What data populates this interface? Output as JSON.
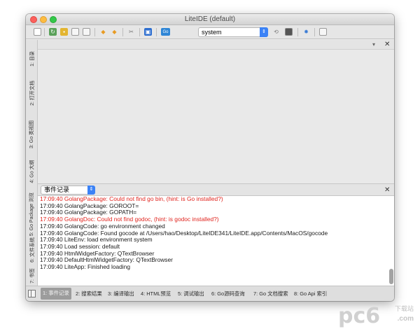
{
  "window": {
    "title": "LiteIDE (default)"
  },
  "toolbar": {
    "icons": [
      "new-file-icon",
      "open-file-icon",
      "open-folder-icon",
      "save-icon",
      "save-all-icon",
      "back-icon",
      "forward-icon",
      "tools-icon",
      "app-icon",
      "go-env-icon",
      "refresh-icon",
      "terminal-icon",
      "settings-icon",
      "window-icon"
    ],
    "env_value": "system"
  },
  "sidebar": {
    "tabs": [
      "1: 目录",
      "2: 打开文档",
      "3: Go 类视图",
      "4: Go 大纲",
      "5: Go Package 浏览",
      "6: 文件系统",
      "7: 书签"
    ]
  },
  "editor": {
    "header_buttons": [
      "▾",
      "✕"
    ]
  },
  "output": {
    "selector_value": "事件记录",
    "close_label": "✕",
    "log": [
      {
        "text": "17:09:40 GolangPackage: Could not find go bin, (hint: is Go installed?)",
        "level": "error"
      },
      {
        "text": "17:09:40 GolangPackage: GOROOT=",
        "level": "info"
      },
      {
        "text": "17:09:40 GolangPackage: GOPATH=",
        "level": "info"
      },
      {
        "text": "17:09:40 GolangDoc: Could not find godoc, (hint: is godoc installed?)",
        "level": "error"
      },
      {
        "text": "17:09:40 GolangCode: go environment changed",
        "level": "info"
      },
      {
        "text": "17:09:40 GolangCode: Found gocode at /Users/hao/Desktop/LiteIDE341/LiteIDE.app/Contents/MacOS/gocode",
        "level": "info"
      },
      {
        "text": "17:09:40 LiteEnv: load environment system",
        "level": "info"
      },
      {
        "text": "17:09:40 Load session: default",
        "level": "info"
      },
      {
        "text": "17:09:40 HtmlWidgetFactory: QTextBrowser",
        "level": "info"
      },
      {
        "text": "17:09:40 DefaultHtmlWidgetFactory: QTextBrowser",
        "level": "info"
      },
      {
        "text": "17:09:40 LiteApp: Finished loading",
        "level": "info"
      }
    ]
  },
  "bottom_tabs": [
    {
      "label": "1: 事件记录",
      "active": true
    },
    {
      "label": "2: 搜索结果",
      "active": false
    },
    {
      "label": "3: 编译输出",
      "active": false
    },
    {
      "label": "4: HTML预览",
      "active": false
    },
    {
      "label": "5: 调试输出",
      "active": false
    },
    {
      "label": "6: Go源码查询",
      "active": false
    },
    {
      "label": "7: Go 文档搜索",
      "active": false
    },
    {
      "label": "8: Go Api 索引",
      "active": false
    }
  ],
  "watermark": {
    "brand": "pc6",
    "sub": "下载站",
    "domain": ".com"
  },
  "colors": {
    "error_text": "#e0241e",
    "accent": "#3b82f6"
  }
}
